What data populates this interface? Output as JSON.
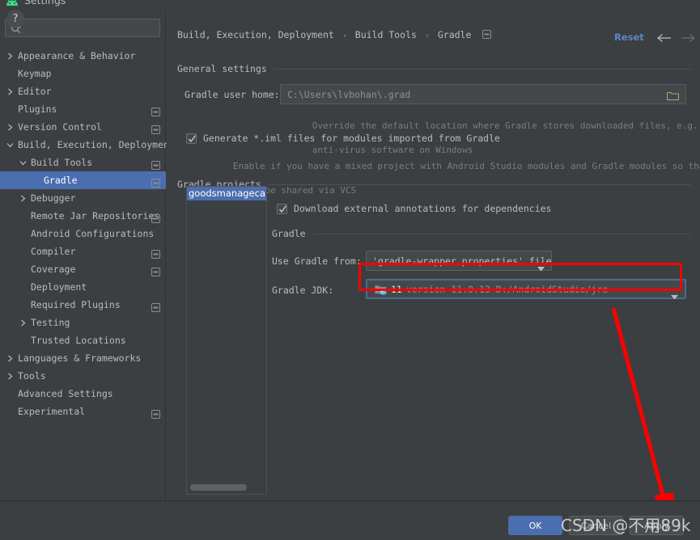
{
  "window": {
    "title": "Settings",
    "icon": "android-studio-icon"
  },
  "sidebar": {
    "search": {
      "placeholder": "",
      "value": "",
      "icon": "search-icon"
    },
    "items": [
      {
        "label": "Appearance & Behavior",
        "indent": 0,
        "arrow": "collapsed",
        "badge": false,
        "selected": false
      },
      {
        "label": "Keymap",
        "indent": 0,
        "arrow": "none",
        "badge": false,
        "selected": false
      },
      {
        "label": "Editor",
        "indent": 0,
        "arrow": "collapsed",
        "badge": false,
        "selected": false
      },
      {
        "label": "Plugins",
        "indent": 0,
        "arrow": "none",
        "badge": true,
        "selected": false
      },
      {
        "label": "Version Control",
        "indent": 0,
        "arrow": "collapsed",
        "badge": true,
        "selected": false
      },
      {
        "label": "Build, Execution, Deployment",
        "indent": 0,
        "arrow": "expanded",
        "badge": false,
        "selected": false
      },
      {
        "label": "Build Tools",
        "indent": 1,
        "arrow": "expanded",
        "badge": true,
        "selected": false
      },
      {
        "label": "Gradle",
        "indent": 2,
        "arrow": "none",
        "badge": true,
        "selected": true
      },
      {
        "label": "Debugger",
        "indent": 1,
        "arrow": "collapsed",
        "badge": false,
        "selected": false
      },
      {
        "label": "Remote Jar Repositories",
        "indent": 1,
        "arrow": "none",
        "badge": true,
        "selected": false
      },
      {
        "label": "Android Configurations",
        "indent": 1,
        "arrow": "none",
        "badge": false,
        "selected": false
      },
      {
        "label": "Compiler",
        "indent": 1,
        "arrow": "none",
        "badge": true,
        "selected": false
      },
      {
        "label": "Coverage",
        "indent": 1,
        "arrow": "none",
        "badge": true,
        "selected": false
      },
      {
        "label": "Deployment",
        "indent": 1,
        "arrow": "none",
        "badge": false,
        "selected": false
      },
      {
        "label": "Required Plugins",
        "indent": 1,
        "arrow": "none",
        "badge": true,
        "selected": false
      },
      {
        "label": "Testing",
        "indent": 1,
        "arrow": "collapsed",
        "badge": false,
        "selected": false
      },
      {
        "label": "Trusted Locations",
        "indent": 1,
        "arrow": "none",
        "badge": false,
        "selected": false
      },
      {
        "label": "Languages & Frameworks",
        "indent": 0,
        "arrow": "collapsed",
        "badge": false,
        "selected": false
      },
      {
        "label": "Tools",
        "indent": 0,
        "arrow": "collapsed",
        "badge": false,
        "selected": false
      },
      {
        "label": "Advanced Settings",
        "indent": 0,
        "arrow": "none",
        "badge": false,
        "selected": false
      },
      {
        "label": "Experimental",
        "indent": 0,
        "arrow": "none",
        "badge": true,
        "selected": false
      }
    ]
  },
  "main": {
    "breadcrumb": {
      "part1": "Build, Execution, Deployment",
      "part2": "Build Tools",
      "part3": "Gradle",
      "separator": "›",
      "badge_icon": "project-settings-badge-icon"
    },
    "reset_label": "Reset",
    "nav_back_icon": "arrow-left-icon",
    "nav_forward_icon": "arrow-right-icon",
    "general_settings": {
      "section_title": "General settings",
      "gradle_user_home_label": "Gradle user home:",
      "gradle_user_home_value": "C:\\Users\\lvbohan\\.grad",
      "browse_icon": "folder-browse-icon",
      "gradle_user_home_hint_line1": "Override the default location where Gradle stores downloaded files, e.g. to tune",
      "gradle_user_home_hint_line2": "anti-virus software on Windows",
      "generate_iml_label": "Generate *.iml files for modules imported from Gradle",
      "generate_iml_checked": true,
      "generate_iml_hint_line1": "Enable if you have a mixed project with Android Studio modules and Gradle modules so that it",
      "generate_iml_hint_line2": "could be shared via VCS"
    },
    "gradle_projects": {
      "section_title": "Gradle projects",
      "project_items": [
        "goodsmanagecabin"
      ],
      "download_annotations_label": "Download external annotations for dependencies",
      "download_annotations_checked": true,
      "gradle_section_title": "Gradle",
      "use_gradle_from_label": "Use Gradle from:",
      "use_gradle_from_value": "'gradle-wrapper.properties' file",
      "gradle_jdk_label": "Gradle JDK:",
      "gradle_jdk_icon": "java-folder-icon",
      "gradle_jdk_version": "11",
      "gradle_jdk_path": "version 11.0.13 D:/AndroidStudio/jre",
      "caret_icon": "chevron-down-icon"
    },
    "annotation": {
      "highlight_color": "#ff0000",
      "arrow_icon": "red-arrow-annotation"
    }
  },
  "footer": {
    "help_label": "?",
    "help_icon": "help-circle-icon",
    "ok_label": "OK",
    "cancel_label": "Cancel",
    "apply_label": "Apply"
  },
  "watermark": {
    "text": "CSDN @不用89k"
  },
  "colors": {
    "background": "#3c3f41",
    "selection": "#4b6eaf",
    "text": "#bbbbbb",
    "hint": "#7a7d7e",
    "link": "#5a87c4",
    "annotation": "#ff0000"
  }
}
